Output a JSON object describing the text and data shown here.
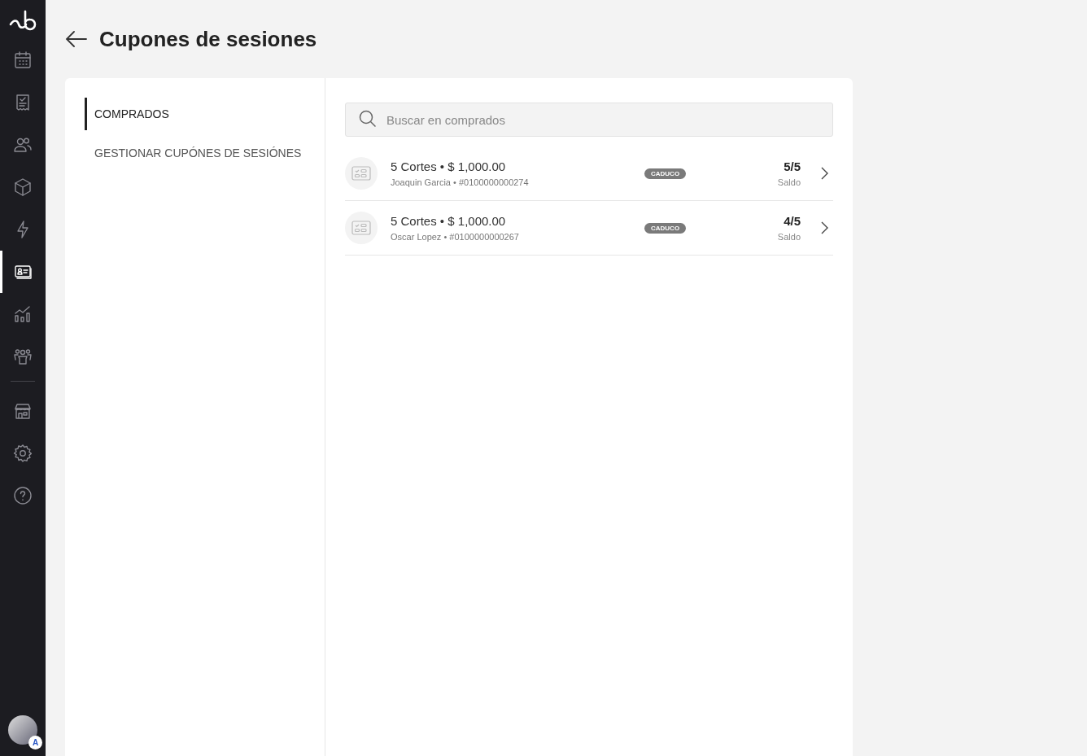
{
  "sidebar": {
    "sections": [
      [
        {
          "kind": "calendar",
          "selected": false
        },
        {
          "kind": "receipt",
          "selected": false
        },
        {
          "kind": "people",
          "selected": false
        },
        {
          "kind": "box",
          "selected": false
        },
        {
          "kind": "bolt",
          "selected": false
        },
        {
          "kind": "card",
          "selected": true
        },
        {
          "kind": "chart",
          "selected": false
        },
        {
          "kind": "team",
          "selected": false
        }
      ],
      [
        {
          "kind": "store",
          "selected": false
        },
        {
          "kind": "gear",
          "selected": false
        },
        {
          "kind": "help",
          "selected": false
        }
      ]
    ],
    "avatar_badge": "A"
  },
  "header": {
    "title": "Cupones de sesiones"
  },
  "menu": [
    {
      "label": "COMPRADOS",
      "selected": true
    },
    {
      "label": "GESTIONAR CUPÓNES DE SESIÓNES",
      "selected": false
    }
  ],
  "search": {
    "placeholder": "Buscar en comprados"
  },
  "coupons": [
    {
      "title": "5 Cortes • $ 1,000.00",
      "subtitle": "Joaquin Garcia • #0100000000274",
      "status": "CADUCO",
      "balance": "5/5",
      "balance_label": "Saldo"
    },
    {
      "title": "5 Cortes • $ 1,000.00",
      "subtitle": "Oscar Lopez • #0100000000267",
      "status": "CADUCO",
      "balance": "4/5",
      "balance_label": "Saldo"
    }
  ]
}
